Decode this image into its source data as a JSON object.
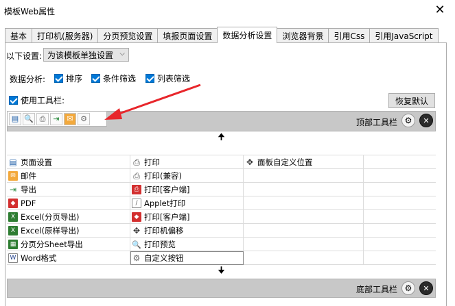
{
  "window": {
    "title": "模板Web属性"
  },
  "tabs": [
    {
      "label": "基本",
      "active": false
    },
    {
      "label": "打印机(服务器)",
      "active": false
    },
    {
      "label": "分页预览设置",
      "active": false
    },
    {
      "label": "填报页面设置",
      "active": false
    },
    {
      "label": "数据分析设置",
      "active": true
    },
    {
      "label": "浏览器背景",
      "active": false
    },
    {
      "label": "引用Css",
      "active": false
    },
    {
      "label": "引用JavaScript",
      "active": false
    }
  ],
  "settings": {
    "label": "以下设置:",
    "select_value": "为该模板单独设置",
    "data_analysis_label": "数据分析:",
    "options": [
      "排序",
      "条件筛选",
      "列表筛选"
    ],
    "use_toolbar_label": "使用工具栏:",
    "restore_default": "恢复默认"
  },
  "top_toolbar": {
    "label": "顶部工具栏"
  },
  "bottom_toolbar": {
    "label": "底部工具栏"
  },
  "grid": {
    "col1": [
      "页面设置",
      "邮件",
      "导出",
      "PDF",
      "Excel(分页导出)",
      "Excel(原样导出)",
      "分页分Sheet导出",
      "Word格式"
    ],
    "col2": [
      "打印",
      "打印(兼容)",
      "打印[客户端]",
      "Applet打印",
      "打印[客户端]",
      "打印机偏移",
      "打印预览",
      "自定义按钮"
    ],
    "col3": [
      "面板自定义位置"
    ]
  },
  "colors": {
    "accent": "#0078d7",
    "arrow": "#e8262b",
    "toolbar_bg": "#c8c8c8"
  }
}
